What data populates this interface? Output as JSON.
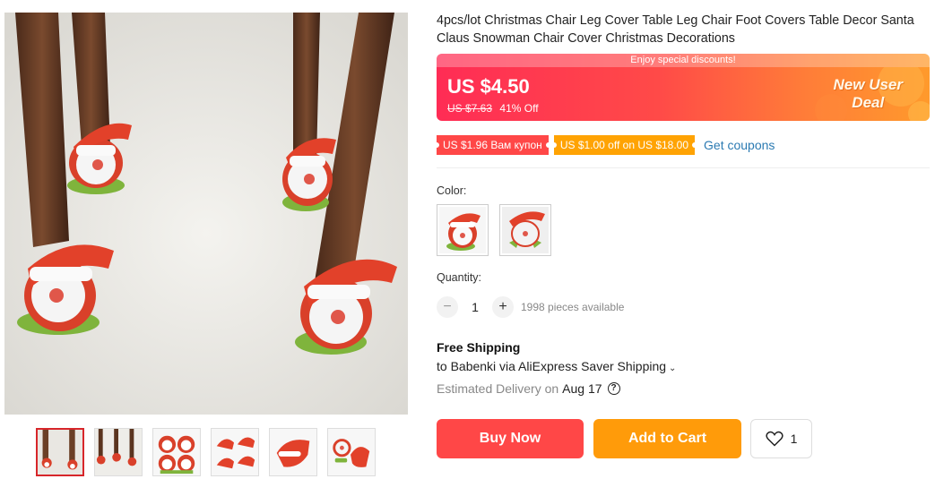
{
  "product": {
    "title": "4pcs/lot Christmas Chair Leg Cover Table Leg Chair Foot Covers Table Decor Santa Claus Snowman Chair Cover Christmas Decorations"
  },
  "price": {
    "banner_text": "Enjoy special discounts!",
    "current": "US $4.50",
    "original": "US $7.63",
    "discount": "41% Off",
    "badge_line1": "New User",
    "badge_line2": "Deal"
  },
  "coupons": [
    {
      "label": "US $1.96 Вам купон"
    },
    {
      "label": "US $1.00 off on US $18.00"
    }
  ],
  "get_coupons_label": "Get coupons",
  "color": {
    "label": "Color:",
    "options": [
      "santa-front",
      "santa-back"
    ]
  },
  "quantity": {
    "label": "Quantity:",
    "minus": "−",
    "plus": "+",
    "value": "1",
    "available": "1998 pieces available"
  },
  "shipping": {
    "title": "Free Shipping",
    "destination": "to Babenki via AliExpress Saver Shipping",
    "caret": "⌄",
    "delivery_label": "Estimated Delivery on",
    "delivery_date": "Aug 17",
    "help": "?"
  },
  "actions": {
    "buy_now": "Buy Now",
    "add_to_cart": "Add to Cart",
    "wishlist_count": "1"
  },
  "gallery": {
    "thumbnail_count": 6,
    "active_index": 0
  },
  "colors": {
    "accent_red": "#ff4747",
    "accent_orange": "#ffa303",
    "link_blue": "#2b7ab2"
  }
}
